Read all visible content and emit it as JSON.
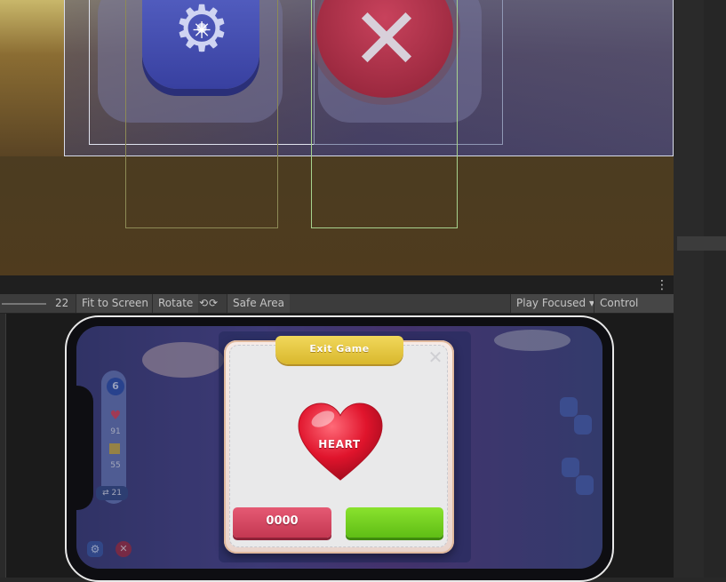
{
  "toolbar": {
    "scale_value": "22",
    "fit_to_screen": "Fit to Screen",
    "rotate": "Rotate",
    "rotate_icons": "⟲⟳",
    "safe_area": "Safe Area",
    "play_focused": "Play Focused",
    "play_focused_caret": "▾",
    "control_panel": "Control Panel",
    "more_icon": "⋮"
  },
  "scene": {
    "move_handle_icon": "✳",
    "gear_icon": "⚙",
    "close_icon": "✕"
  },
  "hud": {
    "level": "6",
    "hearts": "91",
    "coins": "55",
    "moves": "⇄ 21",
    "heart_icon": "♥",
    "settings_icon": "⚙",
    "close_icon": "✕"
  },
  "popup": {
    "title": "Exit Game",
    "close_icon": "✕",
    "heart_label": "HEART",
    "left_button": "0000",
    "right_button": ""
  },
  "colors": {
    "popup_title": "#e2c13f",
    "left_button": "#d44862",
    "right_button": "#74d11f",
    "heart": "#e0142c",
    "editor_bg": "#282828"
  }
}
